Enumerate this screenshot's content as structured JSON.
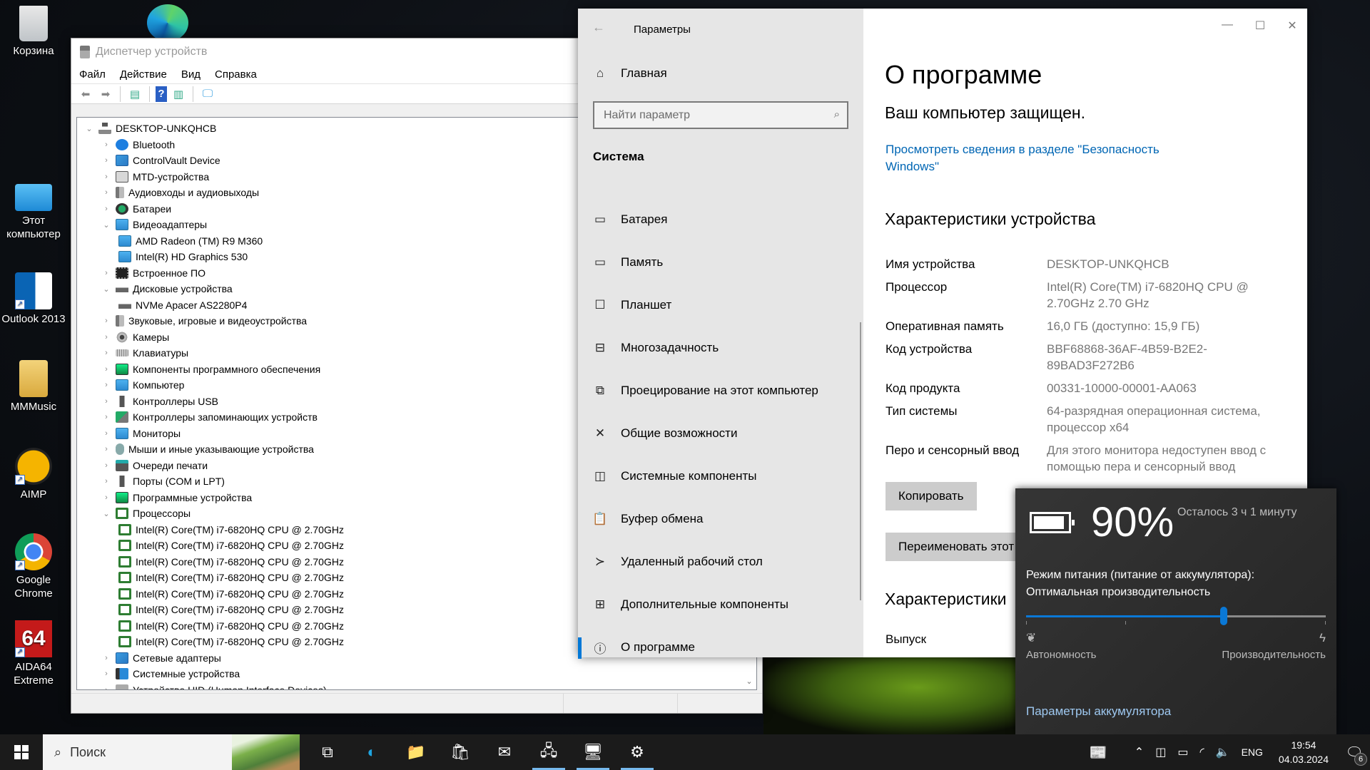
{
  "desktop": {
    "icons": [
      {
        "label": "Корзина",
        "icon": "recycle-bin-icon"
      },
      {
        "label": "Этот компьютер",
        "icon": "this-pc-icon"
      },
      {
        "label": "Outlook 2013",
        "icon": "outlook-icon"
      },
      {
        "label": "MMMusic",
        "icon": "folder-icon"
      },
      {
        "label": "AIMP",
        "icon": "aimp-icon"
      },
      {
        "label": "Google Chrome",
        "icon": "chrome-icon"
      },
      {
        "label": "AIDA64 Extreme",
        "icon": "aida64-icon"
      }
    ]
  },
  "devmgr": {
    "title": "Диспетчер устройств",
    "menu": [
      "Файл",
      "Действие",
      "Вид",
      "Справка"
    ],
    "tree": [
      {
        "label": "DESKTOP-UNKQHCB",
        "level": 0,
        "expanded": true,
        "icon": "pc"
      },
      {
        "label": "Bluetooth",
        "level": 1,
        "expanded": false,
        "icon": "bt"
      },
      {
        "label": "ControlVault Device",
        "level": 1,
        "expanded": false,
        "icon": "net"
      },
      {
        "label": "MTD-устройства",
        "level": 1,
        "expanded": false,
        "icon": "gray"
      },
      {
        "label": "Аудиовходы и аудиовыходы",
        "level": 1,
        "expanded": false,
        "icon": "spk"
      },
      {
        "label": "Батареи",
        "level": 1,
        "expanded": false,
        "icon": "bat"
      },
      {
        "label": "Видеоадаптеры",
        "level": 1,
        "expanded": true,
        "icon": "disp"
      },
      {
        "label": "AMD Radeon (TM) R9 M360",
        "level": 2,
        "icon": "disp"
      },
      {
        "label": "Intel(R) HD Graphics 530",
        "level": 2,
        "icon": "disp"
      },
      {
        "label": "Встроенное ПО",
        "level": 1,
        "expanded": false,
        "icon": "chip"
      },
      {
        "label": "Дисковые устройства",
        "level": 1,
        "expanded": true,
        "icon": "disk"
      },
      {
        "label": "NVMe Apacer AS2280P4",
        "level": 2,
        "icon": "disk"
      },
      {
        "label": "Звуковые, игровые и видеоустройства",
        "level": 1,
        "expanded": false,
        "icon": "spk"
      },
      {
        "label": "Камеры",
        "level": 1,
        "expanded": false,
        "icon": "cam"
      },
      {
        "label": "Клавиатуры",
        "level": 1,
        "expanded": false,
        "icon": "kbd"
      },
      {
        "label": "Компоненты программного обеспечения",
        "level": 1,
        "expanded": false,
        "icon": "comp"
      },
      {
        "label": "Компьютер",
        "level": 1,
        "expanded": false,
        "icon": "disp"
      },
      {
        "label": "Контроллеры USB",
        "level": 1,
        "expanded": false,
        "icon": "usb"
      },
      {
        "label": "Контроллеры запоминающих устройств",
        "level": 1,
        "expanded": false,
        "icon": "stor"
      },
      {
        "label": "Мониторы",
        "level": 1,
        "expanded": false,
        "icon": "disp"
      },
      {
        "label": "Мыши и иные указывающие устройства",
        "level": 1,
        "expanded": false,
        "icon": "mouse"
      },
      {
        "label": "Очереди печати",
        "level": 1,
        "expanded": false,
        "icon": "print"
      },
      {
        "label": "Порты (COM и LPT)",
        "level": 1,
        "expanded": false,
        "icon": "usb"
      },
      {
        "label": "Программные устройства",
        "level": 1,
        "expanded": false,
        "icon": "comp"
      },
      {
        "label": "Процессоры",
        "level": 1,
        "expanded": true,
        "icon": "cpu"
      },
      {
        "label": "Intel(R) Core(TM) i7-6820HQ CPU @ 2.70GHz",
        "level": 2,
        "icon": "cpu"
      },
      {
        "label": "Intel(R) Core(TM) i7-6820HQ CPU @ 2.70GHz",
        "level": 2,
        "icon": "cpu"
      },
      {
        "label": "Intel(R) Core(TM) i7-6820HQ CPU @ 2.70GHz",
        "level": 2,
        "icon": "cpu"
      },
      {
        "label": "Intel(R) Core(TM) i7-6820HQ CPU @ 2.70GHz",
        "level": 2,
        "icon": "cpu"
      },
      {
        "label": "Intel(R) Core(TM) i7-6820HQ CPU @ 2.70GHz",
        "level": 2,
        "icon": "cpu"
      },
      {
        "label": "Intel(R) Core(TM) i7-6820HQ CPU @ 2.70GHz",
        "level": 2,
        "icon": "cpu"
      },
      {
        "label": "Intel(R) Core(TM) i7-6820HQ CPU @ 2.70GHz",
        "level": 2,
        "icon": "cpu"
      },
      {
        "label": "Intel(R) Core(TM) i7-6820HQ CPU @ 2.70GHz",
        "level": 2,
        "icon": "cpu"
      },
      {
        "label": "Сетевые адаптеры",
        "level": 1,
        "expanded": false,
        "icon": "net"
      },
      {
        "label": "Системные устройства",
        "level": 1,
        "expanded": false,
        "icon": "sys"
      },
      {
        "label": "Устройства HID (Human Interface Devices)",
        "level": 1,
        "expanded": false,
        "icon": "hid"
      }
    ]
  },
  "settings": {
    "app_title": "Параметры",
    "home_label": "Главная",
    "search_placeholder": "Найти параметр",
    "section_label": "Система",
    "nav": [
      {
        "label": "Батарея",
        "icon": "battery-icon",
        "glyph": "▭"
      },
      {
        "label": "Память",
        "icon": "storage-icon",
        "glyph": "▭"
      },
      {
        "label": "Планшет",
        "icon": "tablet-icon",
        "glyph": "☐"
      },
      {
        "label": "Многозадачность",
        "icon": "multitasking-icon",
        "glyph": "⊟"
      },
      {
        "label": "Проецирование на этот компьютер",
        "icon": "projecting-icon",
        "glyph": "⧉"
      },
      {
        "label": "Общие возможности",
        "icon": "shared-experiences-icon",
        "glyph": "✕"
      },
      {
        "label": "Системные компоненты",
        "icon": "system-components-icon",
        "glyph": "◫"
      },
      {
        "label": "Буфер обмена",
        "icon": "clipboard-icon",
        "glyph": "📋"
      },
      {
        "label": "Удаленный рабочий стол",
        "icon": "remote-desktop-icon",
        "glyph": "≻"
      },
      {
        "label": "Дополнительные компоненты",
        "icon": "optional-features-icon",
        "glyph": "⊞"
      },
      {
        "label": "О программе",
        "icon": "info-icon",
        "glyph": "ⓘ",
        "active": true
      }
    ],
    "page_title": "О программе",
    "protected": "Ваш компьютер защищен.",
    "security_link": "Просмотреть сведения в разделе \"Безопасность Windows\"",
    "device_specs_title": "Характеристики устройства",
    "specs": [
      {
        "key": "Имя устройства",
        "value": "DESKTOP-UNKQHCB"
      },
      {
        "key": "Процессор",
        "value": "Intel(R) Core(TM) i7-6820HQ CPU @ 2.70GHz   2.70 GHz"
      },
      {
        "key": "Оперативная память",
        "value": "16,0 ГБ (доступно: 15,9 ГБ)"
      },
      {
        "key": "Код устройства",
        "value": "BBF68868-36AF-4B59-B2E2-89BAD3F272B6"
      },
      {
        "key": "Код продукта",
        "value": "00331-10000-00001-AA063"
      },
      {
        "key": "Тип системы",
        "value": "64-разрядная операционная система, процессор x64"
      },
      {
        "key": "Перо и сенсорный ввод",
        "value": "Для этого монитора недоступен ввод с помощью пера и сенсорный ввод"
      }
    ],
    "copy_button": "Копировать",
    "rename_button": "Переименовать этот",
    "windows_specs_title": "Характеристики",
    "edition_key": "Выпуск"
  },
  "battery": {
    "percent": "90%",
    "remaining": "Осталось 3 ч 1 минуту",
    "mode_line1": "Режим питания (питание от аккумулятора):",
    "mode_line2": "Оптимальная производительность",
    "slider_value_percent": 66,
    "slider_min_label": "Автономность",
    "slider_max_label": "Производительность",
    "settings_link": "Параметры аккумулятора"
  },
  "taskbar": {
    "search_placeholder": "Поиск",
    "apps": [
      {
        "name": "task-view",
        "glyph": "⧉",
        "running": false
      },
      {
        "name": "edge",
        "glyph": "◐",
        "running": false
      },
      {
        "name": "file-explorer",
        "glyph": "📁",
        "running": false
      },
      {
        "name": "store",
        "glyph": "🛍",
        "running": false
      },
      {
        "name": "mail",
        "glyph": "✉",
        "running": false
      },
      {
        "name": "device-manager",
        "glyph": "🖧",
        "running": true
      },
      {
        "name": "system",
        "glyph": "🖥",
        "running": true
      },
      {
        "name": "settings",
        "glyph": "⚙",
        "running": true
      }
    ],
    "language": "ENG",
    "time": "19:54",
    "date": "04.03.2024",
    "notification_count": "6"
  }
}
